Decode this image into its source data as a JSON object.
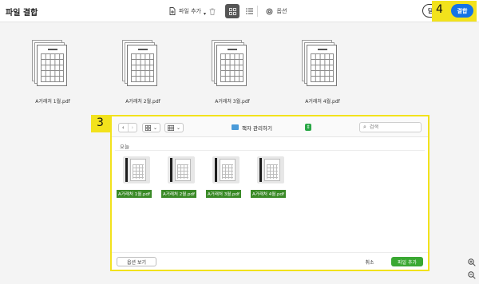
{
  "app": {
    "title": "파일 결합"
  },
  "toolbar": {
    "add_files_label": "파일 추가",
    "delete_icon": "trash-icon",
    "grid_view_icon": "grid-view-icon",
    "list_view_icon": "list-view-icon",
    "options_label": "옵션",
    "close_label": "닫기",
    "combine_label": "결합"
  },
  "callouts": {
    "toolbar_marker": "4",
    "dialog_marker": "3"
  },
  "files": [
    {
      "name": "A거래처 1월.pdf"
    },
    {
      "name": "A거래처 2월.pdf"
    },
    {
      "name": "A거래처 3월.pdf"
    },
    {
      "name": "A거래처 4월.pdf"
    }
  ],
  "dialog": {
    "back_arrow": "‹",
    "forward_arrow": "›",
    "icon_view_caret": "⌄",
    "group_view_caret": "⌄",
    "folder": "책자 관리하기",
    "search_placeholder": "검색",
    "section": "오늘",
    "files": [
      {
        "name": "A거래처 1월.pdf"
      },
      {
        "name": "A거래처 2월.pdf"
      },
      {
        "name": "A거래처 3월.pdf"
      },
      {
        "name": "A거래처 4월.pdf"
      }
    ],
    "options_button": "옵션 보기",
    "cancel_button": "취소",
    "add_button": "파일 추가"
  },
  "colors": {
    "accent_blue": "#1473e6",
    "highlight_yellow": "#f2e21c",
    "confirm_green": "#3aa832"
  }
}
